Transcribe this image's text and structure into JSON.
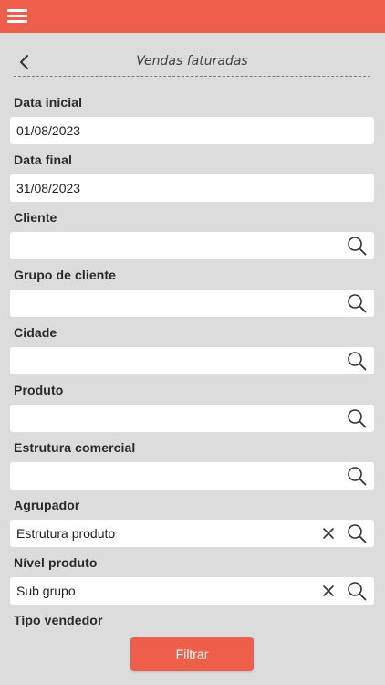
{
  "app": {
    "title": "Vendas faturadas",
    "accent_color": "#ef5e4a",
    "menu_icon": "hamburger-menu-icon",
    "back_icon": "chevron-left-icon"
  },
  "fields": [
    {
      "label": "Data inicial",
      "value": "01/08/2023",
      "has_search": false,
      "has_clear": false
    },
    {
      "label": "Data final",
      "value": "31/08/2023",
      "has_search": false,
      "has_clear": false
    },
    {
      "label": "Cliente",
      "value": "",
      "has_search": true,
      "has_clear": false
    },
    {
      "label": "Grupo de cliente",
      "value": "",
      "has_search": true,
      "has_clear": false
    },
    {
      "label": "Cidade",
      "value": "",
      "has_search": true,
      "has_clear": false
    },
    {
      "label": "Produto",
      "value": "",
      "has_search": true,
      "has_clear": false
    },
    {
      "label": "Estrutura comercial",
      "value": "",
      "has_search": true,
      "has_clear": false
    },
    {
      "label": "Agrupador",
      "value": "Estrutura produto",
      "has_search": true,
      "has_clear": true
    },
    {
      "label": "Nível produto",
      "value": "Sub grupo",
      "has_search": true,
      "has_clear": true
    },
    {
      "label": "Tipo vendedor"
    }
  ],
  "actions": {
    "filter_label": "Filtrar"
  }
}
